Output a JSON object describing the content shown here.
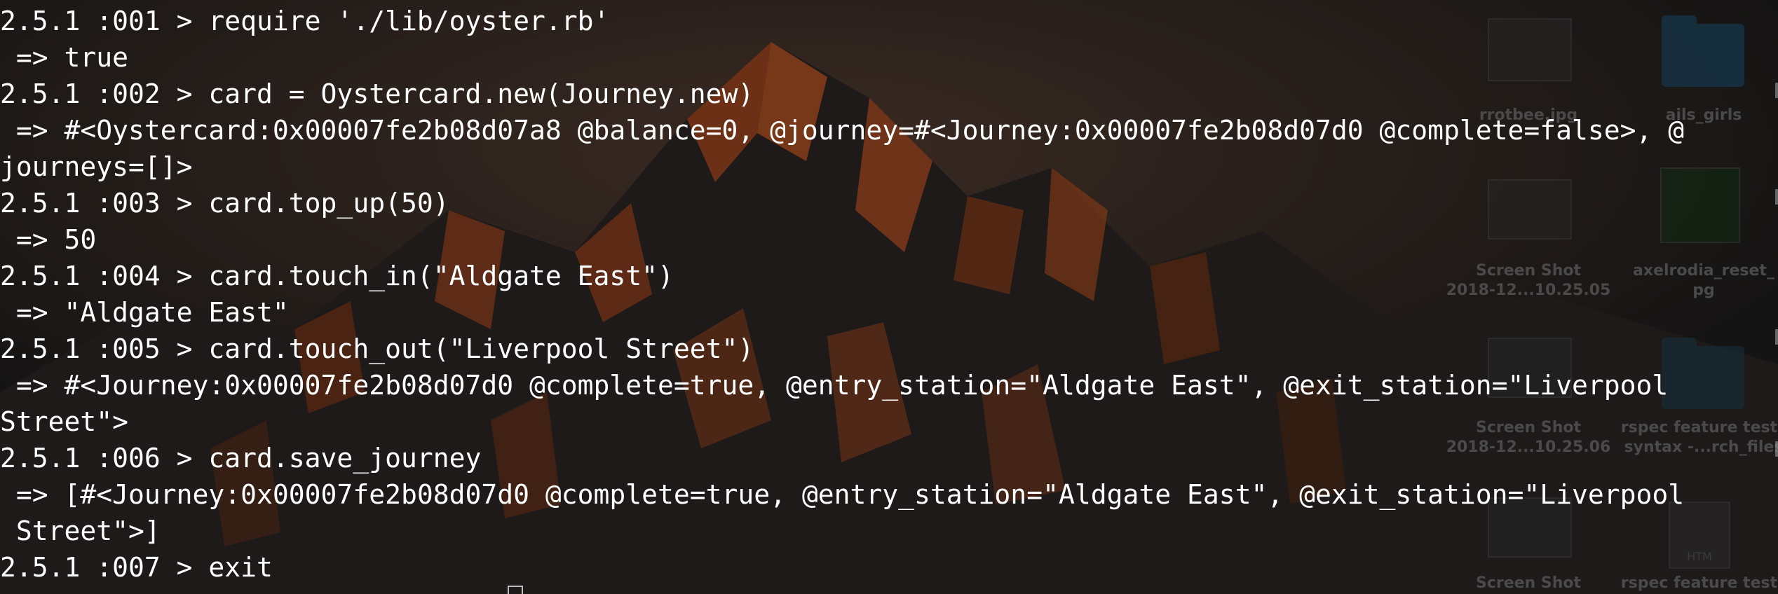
{
  "terminal": {
    "lines": [
      "2.5.1 :001 > require './lib/oyster.rb'",
      " => true",
      "2.5.1 :002 > card = Oystercard.new(Journey.new)",
      " => #<Oystercard:0x00007fe2b08d07a8 @balance=0, @journey=#<Journey:0x00007fe2b08d07d0 @complete=false>, @",
      "journeys=[]>",
      "2.5.1 :003 > card.top_up(50)",
      " => 50",
      "2.5.1 :004 > card.touch_in(\"Aldgate East\")",
      " => \"Aldgate East\"",
      "2.5.1 :005 > card.touch_out(\"Liverpool Street\")",
      " => #<Journey:0x00007fe2b08d07d0 @complete=true, @entry_station=\"Aldgate East\", @exit_station=\"Liverpool",
      "Street\">",
      "2.5.1 :006 > card.save_journey",
      " => [#<Journey:0x00007fe2b08d07d0 @complete=true, @entry_station=\"Aldgate East\", @exit_station=\"Liverpool",
      " Street\">]",
      "2.5.1 :007 > exit"
    ],
    "text_color": "#ffffff"
  },
  "desktop": {
    "icons": [
      {
        "label": "rrotbee.jpg",
        "icon": "image-thumbnail-icon"
      },
      {
        "label": "ails_girls",
        "icon": "folder-icon"
      },
      {
        "label": "Screen Shot",
        "label2": "2018-12...10.25.05",
        "icon": "screenshot-thumbnail-icon"
      },
      {
        "label": "axelrodia_reset_",
        "label2": "pg",
        "icon": "image-thumbnail-icon"
      },
      {
        "label": "Screen Shot",
        "label2": "2018-12...10.25.06",
        "icon": "screenshot-thumbnail-icon"
      },
      {
        "label": "rspec feature tests",
        "label2": "syntax -...rch_files",
        "icon": "folder-icon"
      },
      {
        "label": "Screen Shot",
        "icon": "screenshot-thumbnail-icon"
      },
      {
        "label": "rspec feature tests",
        "icon": "html-file-icon"
      }
    ],
    "html_badge": "HTM"
  },
  "colors": {
    "background": "#141313",
    "wallpaper_orange": "#8a3e18",
    "wallpaper_dark": "#1c1b1b"
  }
}
